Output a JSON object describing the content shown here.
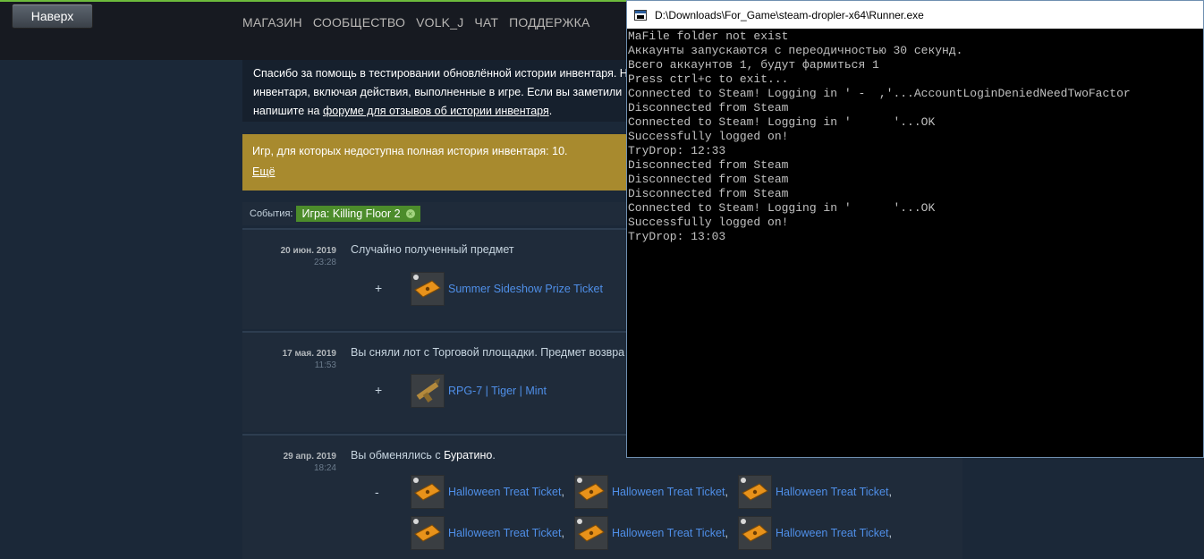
{
  "header": {
    "top_button": "Наверх",
    "nav": [
      "МАГАЗИН",
      "СООБЩЕСТВО",
      "VOLK_J",
      "ЧАТ",
      "ПОДДЕРЖКА"
    ]
  },
  "notice": {
    "line1": "Спасибо за помощь в тестировании обновлённой истории инвентаря. Н",
    "line2": "инвентаря, включая действия, выполненные в игре. Если вы заметили",
    "line3_pre": "напишите на ",
    "link": "форуме для отзывов об истории инвентаря",
    "line3_post": "."
  },
  "warning": {
    "text": "Игр, для которых недоступна полная история инвентаря: 10.",
    "more": "Ещё"
  },
  "filters": {
    "label": "События:",
    "chip": "Игра: Killing Floor 2",
    "chip_close": "×"
  },
  "events": [
    {
      "date": "20 июн. 2019",
      "time": "23:28",
      "description": "Случайно полученный предмет",
      "sign": "+",
      "items": [
        "Summer Sideshow Prize Ticket"
      ]
    },
    {
      "date": "17 мая. 2019",
      "time": "11:53",
      "description": "Вы сняли лот с Торговой площадки. Предмет возвра",
      "sign": "+",
      "items": [
        "RPG-7 | Tiger | Mint"
      ]
    },
    {
      "date": "29 апр. 2019",
      "time": "18:24",
      "description_pre": "Вы обменялись с ",
      "partner": "Буратино",
      "description_post": ".",
      "sign": "-",
      "items": [
        "Halloween Treat Ticket",
        "Halloween Treat Ticket",
        "Halloween Treat Ticket",
        "Halloween Treat Ticket",
        "Halloween Treat Ticket",
        "Halloween Treat Ticket"
      ]
    }
  ],
  "item_separator": ",",
  "console": {
    "title": "D:\\Downloads\\For_Game\\steam-dropler-x64\\Runner.exe",
    "lines": [
      "MaFile folder not exist",
      "Аккаунты запускаются с переодичностью 30 секунд.",
      "Всего аккаунтов 1, будут фармиться 1",
      "Press ctrl+c to exit...",
      "Connected to Steam! Logging in ' -  ,'...AccountLoginDeniedNeedTwoFactor",
      "Disconnected from Steam",
      "Connected to Steam! Logging in '      '...OK",
      "Successfully logged on!",
      "TryDrop: 12:33",
      "Disconnected from Steam",
      "Disconnected from Steam",
      "Disconnected from Steam",
      "Connected to Steam! Logging in '      '...OK",
      "Successfully logged on!",
      "TryDrop: 13:03"
    ]
  },
  "colors": {
    "page_bg": "#1b2838",
    "warning_bg": "#a88a2e",
    "chip_bg": "#4c8c2b",
    "item_link": "#4f8fe8",
    "console_bg": "#000000"
  }
}
